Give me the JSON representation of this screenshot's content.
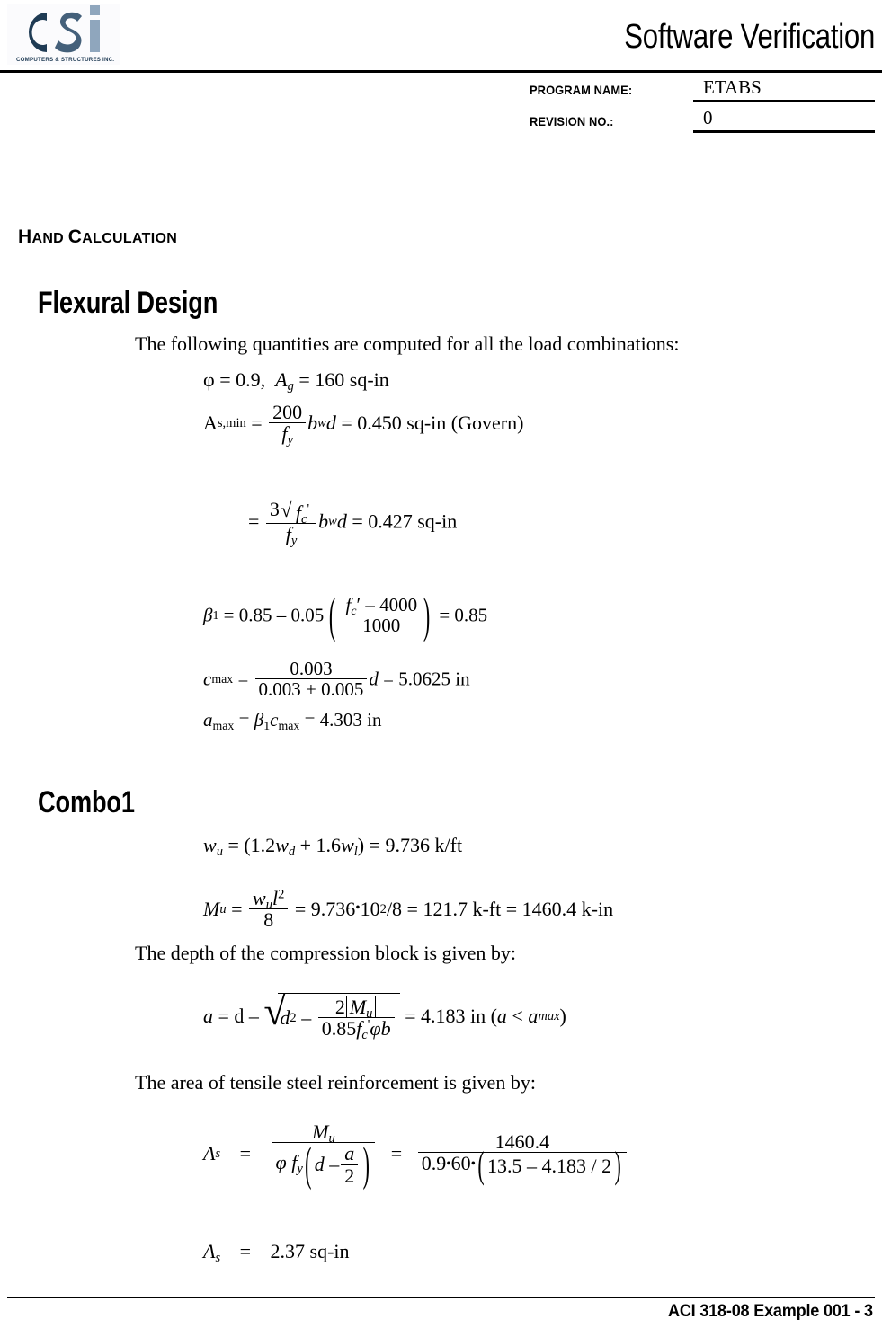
{
  "header": {
    "doc_title": "Software Verification",
    "logo": {
      "wordmark": "CSi",
      "tagline": "COMPUTERS & STRUCTURES INC.",
      "color_dark": "#1f3b54",
      "color_mid": "#44607a",
      "color_light": "#8fa6bd"
    },
    "meta": [
      {
        "label": "PROGRAM NAME:",
        "value": "ETABS"
      },
      {
        "label": "REVISION NO.:",
        "value": "0"
      }
    ]
  },
  "body": {
    "hand_calculation_heading": {
      "c1": "H",
      "r1": "AND",
      "c2": "C",
      "r2": "ALCULATION"
    },
    "section_flexural": "Flexural Design",
    "intro_paragraph": "The following quantities are computed for all the load combinations:",
    "eq_phi_ag": {
      "phi_symbol": "φ",
      "phi_value": "= 0.9,",
      "ag_symbol": "A",
      "ag_sub": "g",
      "ag_value": "= 160 sq-in"
    },
    "eq_as_min": {
      "label": "A",
      "label_sub": "s,min",
      "eq": "=",
      "num": "200",
      "den": "f",
      "den_sub": "y",
      "times": "b",
      "times_sub": "w",
      "times2": "d",
      "result": "= 0.450 sq-in (Govern)"
    },
    "eq_as_min2": {
      "eq": "=",
      "num_coeff": "3",
      "num_var": "f",
      "num_var_sub": "c",
      "num_var_prime": "'",
      "den": "f",
      "den_sub": "y",
      "times": "b",
      "times_sub": "w",
      "times2": "d",
      "result": "= 0.427 sq-in"
    },
    "eq_beta1": {
      "beta": "β",
      "beta_sub": "1",
      "eq1": "= 0.85 – 0.05",
      "num_var": "f",
      "num_var_sub": "c",
      "num_var_prime": "′",
      "num_rest": "– 4000",
      "den": "1000",
      "result": "= 0.85"
    },
    "eq_cmax": {
      "c": "c",
      "c_sub": "max",
      "eq": "=",
      "num": "0.003",
      "den": "0.003 + 0.005",
      "d": "d",
      "result": "= 5.0625 in"
    },
    "eq_amax": {
      "a": "a",
      "a_sub": "max",
      "eq": "=",
      "beta": "β",
      "beta_sub": "1",
      "c": "c",
      "c_sub": "max",
      "result": "= 4.303 in"
    },
    "section_combo1": "Combo1",
    "eq_wu": {
      "w": "w",
      "w_sub": "u",
      "text": "= (1.2",
      "wd": "w",
      "wd_sub": "d",
      "plus": "+ 1.6",
      "wl": "w",
      "wl_sub": "l",
      "result": ") = 9.736 k/ft"
    },
    "eq_mu": {
      "m": "M",
      "m_sub": "u",
      "eq": "=",
      "num_w": "w",
      "num_w_sub": "u",
      "num_l": "l",
      "num_l_sup": "2",
      "den": "8",
      "result_a": "= 9.736",
      "dot": "•",
      "result_b": "10",
      "result_b_sup": "2",
      "result_c": "/8 = 121.7 k-ft = 1460.4 k-in"
    },
    "para_depth": "The depth of the compression block is given by:",
    "eq_a": {
      "a": "a",
      "eq": "= d –",
      "d2": "d",
      "d2_sup": "2",
      "minus": "–",
      "num_coeff": "2",
      "num_m": "M",
      "num_m_sub": "u",
      "den": "0.85",
      "den_f": "f",
      "den_f_sub": "c",
      "den_f_prime": "'",
      "den_phi": "φ",
      "den_b": "b",
      "result": "= 4.183 in (",
      "result_a": "a",
      "result_lt": "<",
      "result_amax": "a",
      "result_amax_sub": "max",
      "result_close": ")"
    },
    "para_area": "The area of tensile steel reinforcement is given by:",
    "eq_as": {
      "as": "A",
      "as_sub": "s",
      "eq1": "=",
      "num_m": "M",
      "num_m_sub": "u",
      "den_phi": "φ",
      "den_f": "f",
      "den_f_sub": "y",
      "den_d": "d –",
      "den_a": "a",
      "den_2": "2",
      "eq2": "=",
      "rnum": "1460.4",
      "rden_a": "0.9",
      "rden_dot1": "•",
      "rden_b": "60",
      "rden_dot2": "•",
      "rden_paren": "13.5 – 4.183 / 2"
    },
    "eq_as_result": {
      "as": "A",
      "as_sub": "s",
      "eq": "=",
      "value": "2.37 sq-in"
    }
  },
  "footer": {
    "text": "ACI 318-08 Example 001 - 3"
  }
}
